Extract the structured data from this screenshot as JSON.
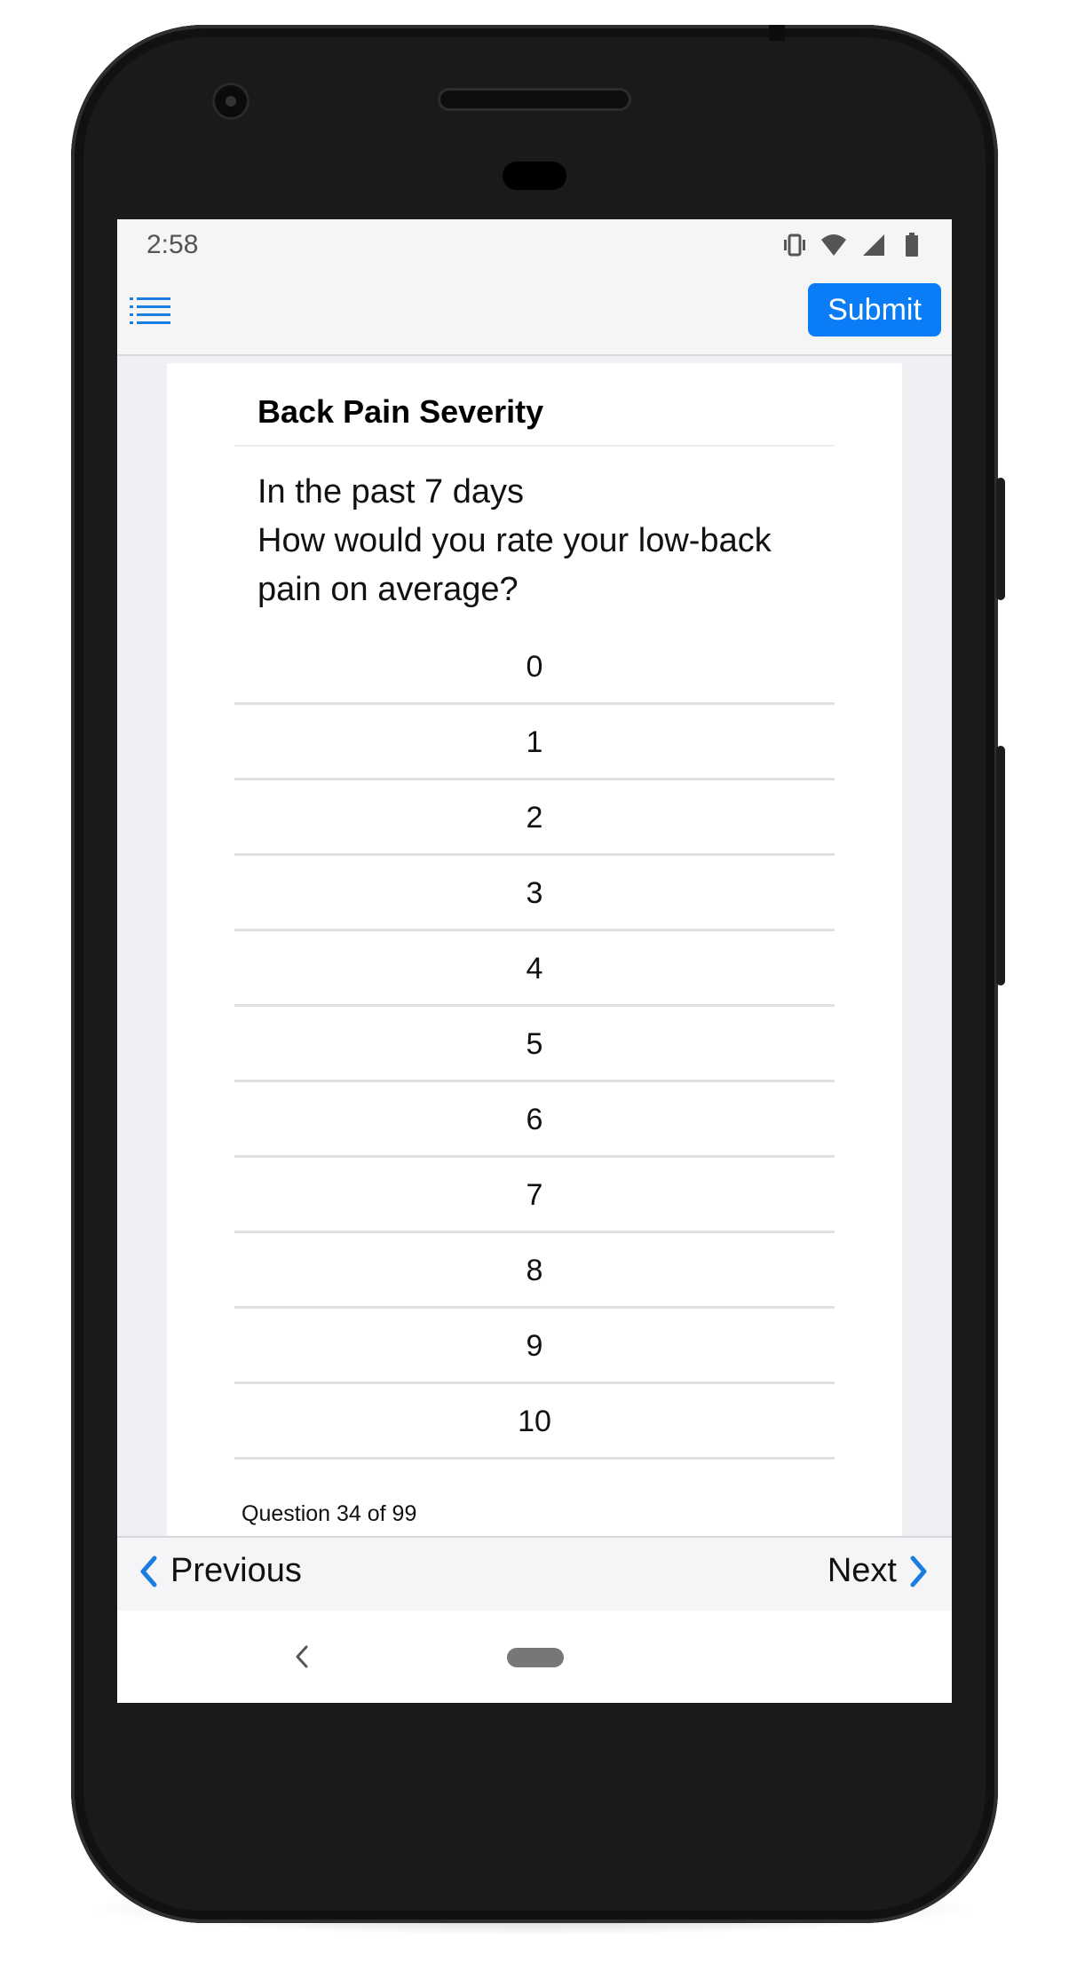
{
  "status_bar": {
    "time": "2:58",
    "icons": [
      "vibrate-icon",
      "wifi-icon",
      "signal-icon",
      "battery-icon"
    ]
  },
  "toolbar": {
    "menu_icon": "list-icon",
    "submit_label": "Submit",
    "accent_color": "#0a7cf5"
  },
  "survey": {
    "title": "Back Pain Severity",
    "question_lines": [
      "In the past 7 days",
      "How would you rate your low-back",
      "pain on average?"
    ],
    "options": [
      "0",
      "1",
      "2",
      "3",
      "4",
      "5",
      "6",
      "7",
      "8",
      "9",
      "10"
    ],
    "counter": "Question 34 of 99"
  },
  "navigation": {
    "previous_label": "Previous",
    "next_label": "Next"
  }
}
